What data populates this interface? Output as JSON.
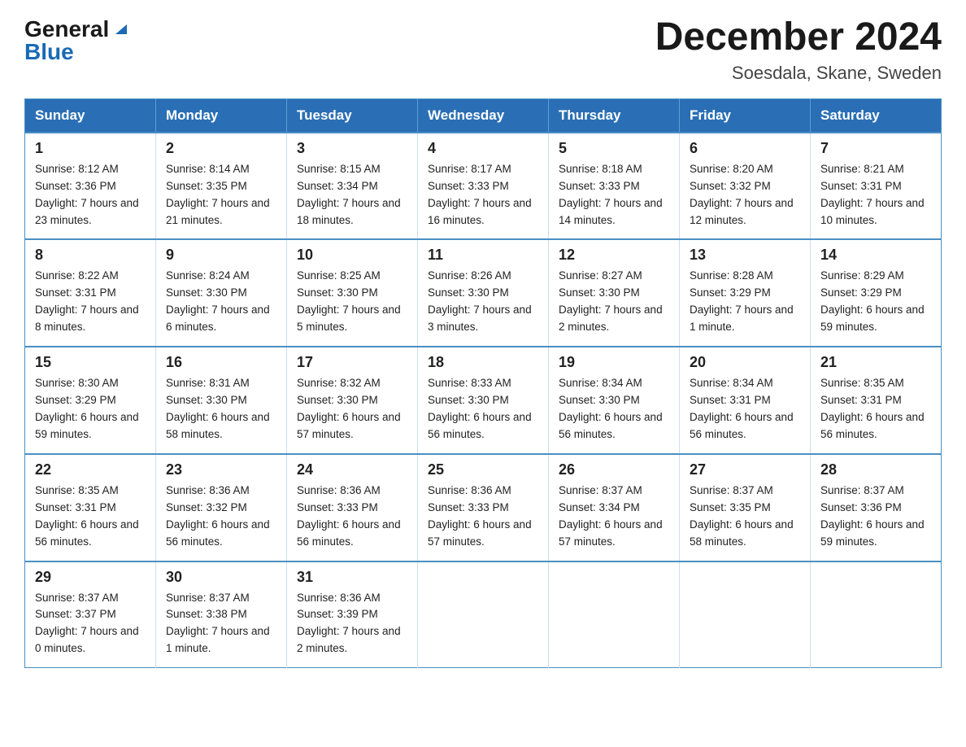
{
  "header": {
    "logo_general": "General",
    "logo_blue": "Blue",
    "month_title": "December 2024",
    "location": "Soesdala, Skane, Sweden"
  },
  "weekdays": [
    "Sunday",
    "Monday",
    "Tuesday",
    "Wednesday",
    "Thursday",
    "Friday",
    "Saturday"
  ],
  "weeks": [
    [
      {
        "day": "1",
        "sunrise": "8:12 AM",
        "sunset": "3:36 PM",
        "daylight": "7 hours and 23 minutes."
      },
      {
        "day": "2",
        "sunrise": "8:14 AM",
        "sunset": "3:35 PM",
        "daylight": "7 hours and 21 minutes."
      },
      {
        "day": "3",
        "sunrise": "8:15 AM",
        "sunset": "3:34 PM",
        "daylight": "7 hours and 18 minutes."
      },
      {
        "day": "4",
        "sunrise": "8:17 AM",
        "sunset": "3:33 PM",
        "daylight": "7 hours and 16 minutes."
      },
      {
        "day": "5",
        "sunrise": "8:18 AM",
        "sunset": "3:33 PM",
        "daylight": "7 hours and 14 minutes."
      },
      {
        "day": "6",
        "sunrise": "8:20 AM",
        "sunset": "3:32 PM",
        "daylight": "7 hours and 12 minutes."
      },
      {
        "day": "7",
        "sunrise": "8:21 AM",
        "sunset": "3:31 PM",
        "daylight": "7 hours and 10 minutes."
      }
    ],
    [
      {
        "day": "8",
        "sunrise": "8:22 AM",
        "sunset": "3:31 PM",
        "daylight": "7 hours and 8 minutes."
      },
      {
        "day": "9",
        "sunrise": "8:24 AM",
        "sunset": "3:30 PM",
        "daylight": "7 hours and 6 minutes."
      },
      {
        "day": "10",
        "sunrise": "8:25 AM",
        "sunset": "3:30 PM",
        "daylight": "7 hours and 5 minutes."
      },
      {
        "day": "11",
        "sunrise": "8:26 AM",
        "sunset": "3:30 PM",
        "daylight": "7 hours and 3 minutes."
      },
      {
        "day": "12",
        "sunrise": "8:27 AM",
        "sunset": "3:30 PM",
        "daylight": "7 hours and 2 minutes."
      },
      {
        "day": "13",
        "sunrise": "8:28 AM",
        "sunset": "3:29 PM",
        "daylight": "7 hours and 1 minute."
      },
      {
        "day": "14",
        "sunrise": "8:29 AM",
        "sunset": "3:29 PM",
        "daylight": "6 hours and 59 minutes."
      }
    ],
    [
      {
        "day": "15",
        "sunrise": "8:30 AM",
        "sunset": "3:29 PM",
        "daylight": "6 hours and 59 minutes."
      },
      {
        "day": "16",
        "sunrise": "8:31 AM",
        "sunset": "3:30 PM",
        "daylight": "6 hours and 58 minutes."
      },
      {
        "day": "17",
        "sunrise": "8:32 AM",
        "sunset": "3:30 PM",
        "daylight": "6 hours and 57 minutes."
      },
      {
        "day": "18",
        "sunrise": "8:33 AM",
        "sunset": "3:30 PM",
        "daylight": "6 hours and 56 minutes."
      },
      {
        "day": "19",
        "sunrise": "8:34 AM",
        "sunset": "3:30 PM",
        "daylight": "6 hours and 56 minutes."
      },
      {
        "day": "20",
        "sunrise": "8:34 AM",
        "sunset": "3:31 PM",
        "daylight": "6 hours and 56 minutes."
      },
      {
        "day": "21",
        "sunrise": "8:35 AM",
        "sunset": "3:31 PM",
        "daylight": "6 hours and 56 minutes."
      }
    ],
    [
      {
        "day": "22",
        "sunrise": "8:35 AM",
        "sunset": "3:31 PM",
        "daylight": "6 hours and 56 minutes."
      },
      {
        "day": "23",
        "sunrise": "8:36 AM",
        "sunset": "3:32 PM",
        "daylight": "6 hours and 56 minutes."
      },
      {
        "day": "24",
        "sunrise": "8:36 AM",
        "sunset": "3:33 PM",
        "daylight": "6 hours and 56 minutes."
      },
      {
        "day": "25",
        "sunrise": "8:36 AM",
        "sunset": "3:33 PM",
        "daylight": "6 hours and 57 minutes."
      },
      {
        "day": "26",
        "sunrise": "8:37 AM",
        "sunset": "3:34 PM",
        "daylight": "6 hours and 57 minutes."
      },
      {
        "day": "27",
        "sunrise": "8:37 AM",
        "sunset": "3:35 PM",
        "daylight": "6 hours and 58 minutes."
      },
      {
        "day": "28",
        "sunrise": "8:37 AM",
        "sunset": "3:36 PM",
        "daylight": "6 hours and 59 minutes."
      }
    ],
    [
      {
        "day": "29",
        "sunrise": "8:37 AM",
        "sunset": "3:37 PM",
        "daylight": "7 hours and 0 minutes."
      },
      {
        "day": "30",
        "sunrise": "8:37 AM",
        "sunset": "3:38 PM",
        "daylight": "7 hours and 1 minute."
      },
      {
        "day": "31",
        "sunrise": "8:36 AM",
        "sunset": "3:39 PM",
        "daylight": "7 hours and 2 minutes."
      },
      null,
      null,
      null,
      null
    ]
  ]
}
